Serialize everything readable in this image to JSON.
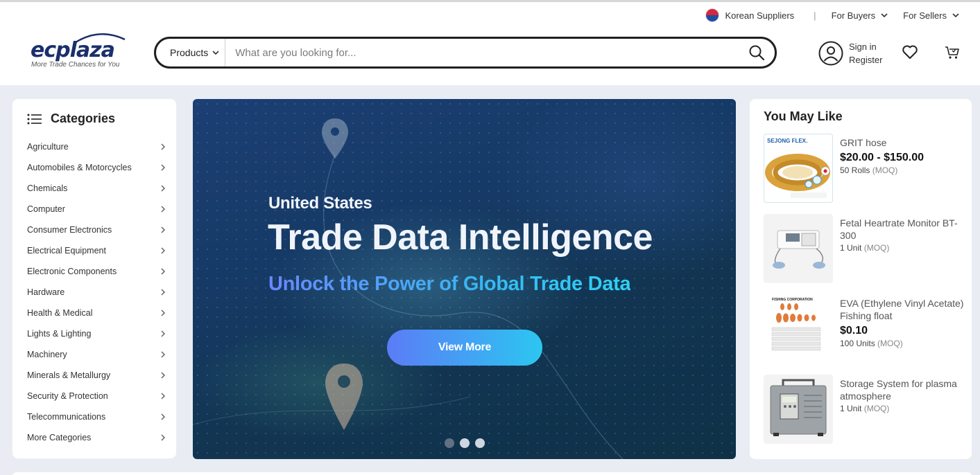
{
  "header": {
    "utility": {
      "korean_suppliers": "Korean Suppliers",
      "separator": "|",
      "for_buyers": "For Buyers",
      "for_sellers": "For Sellers"
    },
    "logo": {
      "wordmark_ec": "ec",
      "wordmark_plaza": "plaza",
      "tagline": "More Trade Chances for You"
    },
    "search": {
      "category": "Products",
      "placeholder": "What are you looking for..."
    },
    "account": {
      "sign_in": "Sign in",
      "register": "Register"
    }
  },
  "categories": {
    "title": "Categories",
    "items": [
      "Agriculture",
      "Automobiles & Motorcycles",
      "Chemicals",
      "Computer",
      "Consumer Electronics",
      "Electrical Equipment",
      "Electronic Components",
      "Hardware",
      "Health & Medical",
      "Lights & Lighting",
      "Machinery",
      "Minerals & Metallurgy",
      "Security & Protection",
      "Telecommunications",
      "More Categories"
    ]
  },
  "banner": {
    "line1": "United States",
    "line2": "Trade Data Intelligence",
    "line3": "Unlock the Power of Global Trade Data",
    "cta": "View More",
    "slides": 3,
    "active_slide": 1
  },
  "you_may_like": {
    "title": "You May Like",
    "moq_label": "(MOQ)",
    "products": [
      {
        "name": "GRIT hose",
        "price": "$20.00 - $150.00",
        "moq": "50 Rolls",
        "thumb_brand": "SEJONG FLEX."
      },
      {
        "name": "Fetal Heartrate Monitor BT-300",
        "price": "",
        "moq": "1 Unit"
      },
      {
        "name": "EVA (Ethylene Vinyl Acetate) Fishing float",
        "price": "$0.10",
        "moq": "100 Units",
        "thumb_brand": "FISHING CORPORATION"
      },
      {
        "name": "Storage System for plasma atmosphere",
        "price": "",
        "moq": "1 Unit"
      }
    ]
  },
  "colors": {
    "page_bg": "#e9edf3",
    "brand_navy": "#1b2f6b",
    "cta_start": "#5b7cf6",
    "cta_end": "#2cc6f1"
  }
}
